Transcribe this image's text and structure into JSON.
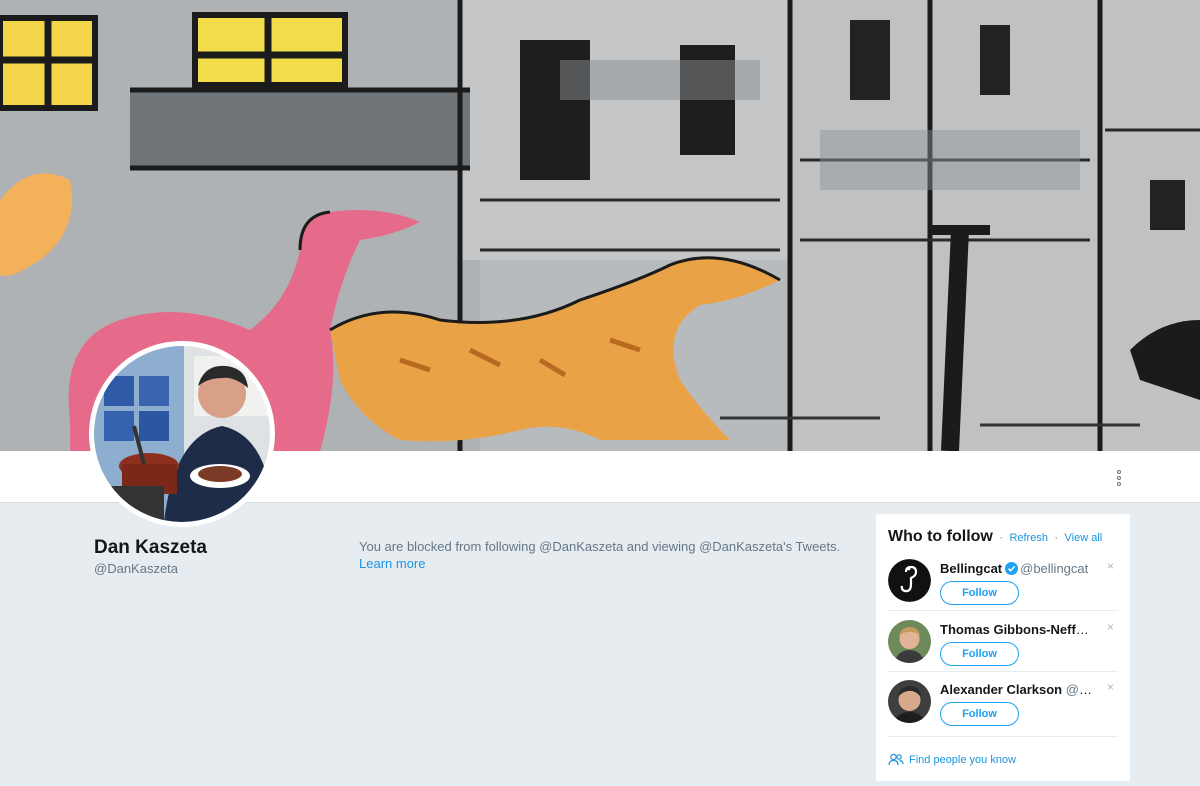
{
  "profile": {
    "name": "Dan Kaszeta",
    "handle": "@DanKaszeta"
  },
  "blocked": {
    "message": "You are blocked from following @DanKaszeta and viewing @DanKaszeta's Tweets.",
    "learn_more": "Learn more"
  },
  "who_to_follow": {
    "title": "Who to follow",
    "refresh": "Refresh",
    "separator": "·",
    "view_all": "View all",
    "follow_label": "Follow",
    "dismiss_label": "×",
    "users": [
      {
        "name": "Bellingcat",
        "handle": "@bellingcat",
        "verified": true
      },
      {
        "name": "Thomas Gibbons-Neff",
        "handle": "…",
        "verified": true
      },
      {
        "name": "Alexander Clarkson",
        "handle": "@AP…",
        "verified": false
      }
    ],
    "find_people": "Find people you know"
  },
  "icons": {
    "more": "more-options-icon",
    "verified": "verified-badge-icon",
    "people": "people-icon"
  },
  "colors": {
    "link": "#1b95e0",
    "follow": "#1da1f2",
    "page_bg": "#e6ecf0"
  }
}
